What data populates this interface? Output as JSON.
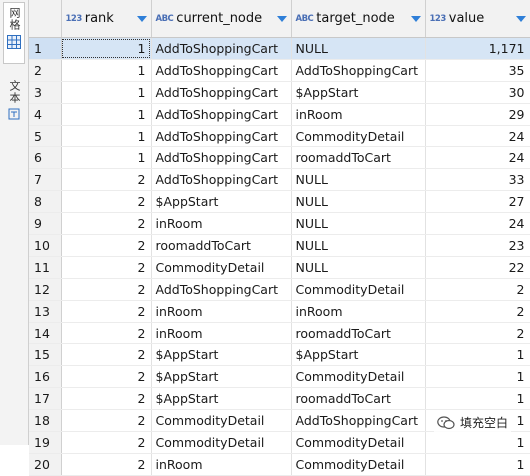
{
  "side_tabs": {
    "grid_tab": "网格",
    "text_tab": "文本"
  },
  "columns": [
    {
      "type": "123",
      "name": "rank"
    },
    {
      "type": "ABC",
      "name": "current_node"
    },
    {
      "type": "ABC",
      "name": "target_node"
    },
    {
      "type": "123",
      "name": "value"
    }
  ],
  "rows": [
    {
      "n": "1",
      "rank": "1",
      "current_node": "AddToShoppingCart",
      "target_node": "NULL",
      "value": "1,171"
    },
    {
      "n": "2",
      "rank": "1",
      "current_node": "AddToShoppingCart",
      "target_node": "AddToShoppingCart",
      "value": "35"
    },
    {
      "n": "3",
      "rank": "1",
      "current_node": "AddToShoppingCart",
      "target_node": "$AppStart",
      "value": "30"
    },
    {
      "n": "4",
      "rank": "1",
      "current_node": "AddToShoppingCart",
      "target_node": "inRoom",
      "value": "29"
    },
    {
      "n": "5",
      "rank": "1",
      "current_node": "AddToShoppingCart",
      "target_node": "CommodityDetail",
      "value": "24"
    },
    {
      "n": "6",
      "rank": "1",
      "current_node": "AddToShoppingCart",
      "target_node": "roomaddToCart",
      "value": "24"
    },
    {
      "n": "7",
      "rank": "2",
      "current_node": "AddToShoppingCart",
      "target_node": "NULL",
      "value": "33"
    },
    {
      "n": "8",
      "rank": "2",
      "current_node": "$AppStart",
      "target_node": "NULL",
      "value": "27"
    },
    {
      "n": "9",
      "rank": "2",
      "current_node": "inRoom",
      "target_node": "NULL",
      "value": "24"
    },
    {
      "n": "10",
      "rank": "2",
      "current_node": "roomaddToCart",
      "target_node": "NULL",
      "value": "23"
    },
    {
      "n": "11",
      "rank": "2",
      "current_node": "CommodityDetail",
      "target_node": "NULL",
      "value": "22"
    },
    {
      "n": "12",
      "rank": "2",
      "current_node": "AddToShoppingCart",
      "target_node": "CommodityDetail",
      "value": "2"
    },
    {
      "n": "13",
      "rank": "2",
      "current_node": "inRoom",
      "target_node": "inRoom",
      "value": "2"
    },
    {
      "n": "14",
      "rank": "2",
      "current_node": "inRoom",
      "target_node": "roomaddToCart",
      "value": "2"
    },
    {
      "n": "15",
      "rank": "2",
      "current_node": "$AppStart",
      "target_node": "$AppStart",
      "value": "1"
    },
    {
      "n": "16",
      "rank": "2",
      "current_node": "$AppStart",
      "target_node": "CommodityDetail",
      "value": "1"
    },
    {
      "n": "17",
      "rank": "2",
      "current_node": "$AppStart",
      "target_node": "roomaddToCart",
      "value": "1"
    },
    {
      "n": "18",
      "rank": "2",
      "current_node": "CommodityDetail",
      "target_node": "AddToShoppingCart",
      "value": "1"
    },
    {
      "n": "19",
      "rank": "2",
      "current_node": "CommodityDetail",
      "target_node": "CommodityDetail",
      "value": "1"
    },
    {
      "n": "20",
      "rank": "2",
      "current_node": "inRoom",
      "target_node": "CommodityDetail",
      "value": "1"
    }
  ],
  "watermark": {
    "text": "填充空白"
  }
}
